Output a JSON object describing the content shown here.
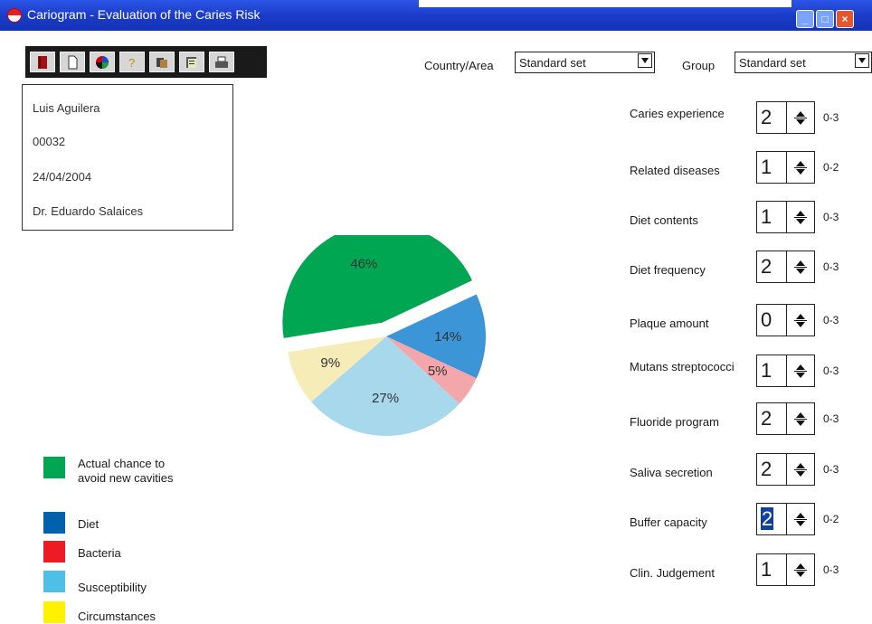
{
  "window": {
    "title": "Cariogram - Evaluation of the Caries Risk",
    "title_bar_color": "#1c3cc8",
    "icon": "cariogram-pie-icon",
    "buttons": [
      "minimize-icon",
      "maximize-icon",
      "close-icon"
    ]
  },
  "toolbar": {
    "buttons": [
      {
        "icon": "book-icon"
      },
      {
        "icon": "new-page-icon"
      },
      {
        "icon": "color-wheel-icon"
      },
      {
        "icon": "help-icon"
      },
      {
        "icon": "cards-icon"
      },
      {
        "icon": "notes-icon"
      },
      {
        "icon": "print-icon"
      }
    ]
  },
  "patient": {
    "name": "Luis Aguilera",
    "id": "00032",
    "date": "24/04/2004",
    "doctor": "Dr. Eduardo Salaices"
  },
  "selectors": {
    "country_label": "Country/Area",
    "country_value": "Standard set",
    "group_label": "Group",
    "group_value": "Standard set"
  },
  "factors": [
    {
      "label": "Caries experience",
      "value": "2",
      "range": "0-3"
    },
    {
      "label": "Related diseases",
      "value": "1",
      "range": "0-2"
    },
    {
      "label": "Diet contents",
      "value": "1",
      "range": "0-3"
    },
    {
      "label": "Diet frequency",
      "value": "2",
      "range": "0-3"
    },
    {
      "label": "Plaque amount",
      "value": "0",
      "range": "0-3"
    },
    {
      "label": "Mutans streptococci",
      "value": "1",
      "range": "0-3"
    },
    {
      "label": "Fluoride program",
      "value": "2",
      "range": "0-3"
    },
    {
      "label": "Saliva secretion",
      "value": "2",
      "range": "0-3"
    },
    {
      "label": "Buffer capacity",
      "value": "2",
      "range": "0-2",
      "selected": true
    },
    {
      "label": "Clin. Judgement",
      "value": "1",
      "range": "0-3"
    }
  ],
  "chart_data": {
    "type": "pie",
    "slices": [
      {
        "label": "46%",
        "value": 46,
        "color": "#00a651",
        "exploded": true
      },
      {
        "label": "14%",
        "value": 14,
        "color": "#3b95d6"
      },
      {
        "label": "5%",
        "value": 5,
        "color": "#f4a7aa"
      },
      {
        "label": "27%",
        "value": 27,
        "color": "#a8d8ec"
      },
      {
        "label": "9%",
        "value": 9,
        "color": "#f5ecb8"
      }
    ]
  },
  "legend": [
    {
      "label": "Actual chance to avoid new cavities",
      "line1": "Actual chance to",
      "line2": "avoid new cavities",
      "color": "#00a651"
    },
    {
      "label": "Diet",
      "color": "#0061ad"
    },
    {
      "label": "Bacteria",
      "color": "#ed1c24"
    },
    {
      "label": "Susceptibility",
      "color": "#4ebfe6"
    },
    {
      "label": "Circumstances",
      "color": "#fff200"
    }
  ]
}
